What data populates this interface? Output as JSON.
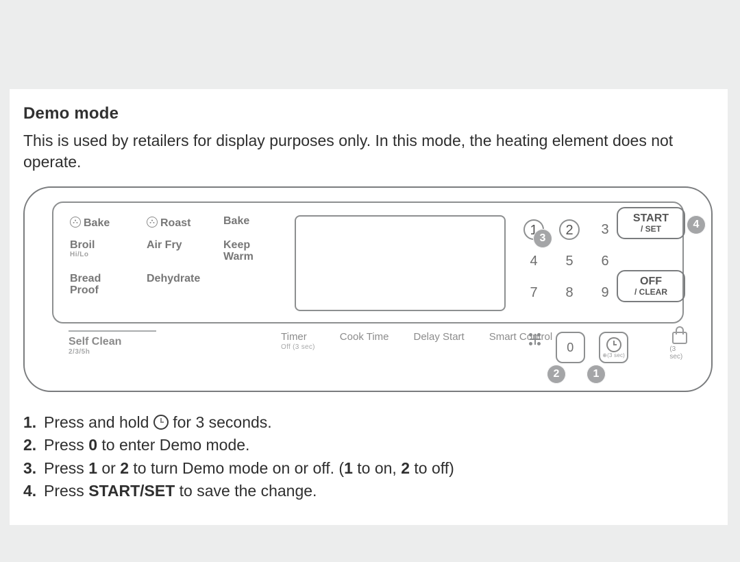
{
  "title": "Demo mode",
  "desc": "This is used by retailers for display purposes only. In this mode, the heating element does not operate.",
  "modes": {
    "r1": {
      "a": "Bake",
      "b": "Roast",
      "c": "Bake"
    },
    "r2": {
      "a": "Broil",
      "asub": "Hi/Lo",
      "b": "Air Fry",
      "c": "Keep Warm"
    },
    "r3": {
      "a": "Bread Proof",
      "b": "Dehydrate"
    }
  },
  "keypad": {
    "k1": "1",
    "k2": "2",
    "k3": "3",
    "k4": "4",
    "k5": "5",
    "k6": "6",
    "k7": "7",
    "k8": "8",
    "k9": "9",
    "k0": "0"
  },
  "buttons": {
    "start": "START",
    "start_sub": "/ SET",
    "off": "OFF",
    "off_sub": "/ CLEAR"
  },
  "self_clean": {
    "label": "Self Clean",
    "sub": "2/3/5h"
  },
  "funcs": {
    "timer": {
      "label": "Timer",
      "sub": "Off (3 sec)"
    },
    "cook": {
      "label": "Cook Time"
    },
    "delay": {
      "label": "Delay Start"
    },
    "smart": {
      "label": "Smart Control"
    }
  },
  "clock_btn_sub": "⊕(3 sec)",
  "lock_sub": "(3 sec)",
  "callouts": {
    "c1": "1",
    "c2": "2",
    "c3": "3",
    "c4": "4"
  },
  "steps": {
    "s1_pre": "Press and hold ",
    "s1_post": " for 3 seconds.",
    "s2_a": "Press ",
    "s2_b": "0",
    "s2_c": " to enter Demo mode.",
    "s3_a": "Press ",
    "s3_b": "1",
    "s3_c": " or ",
    "s3_d": "2",
    "s3_e": " to turn Demo mode on or off. (",
    "s3_f": "1",
    "s3_g": " to on, ",
    "s3_h": "2",
    "s3_i": " to off)",
    "s4_a": "Press ",
    "s4_b": "START/SET",
    "s4_c": " to save the change."
  }
}
